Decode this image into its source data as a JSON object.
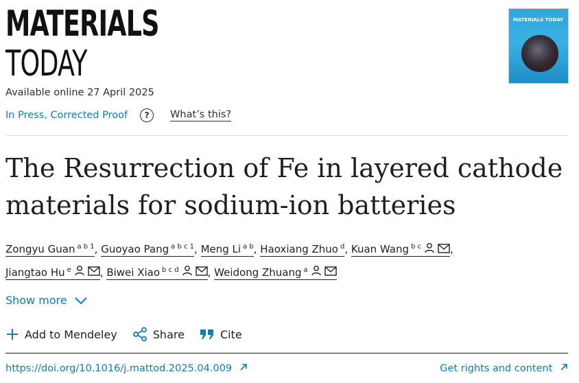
{
  "journal": {
    "name_line1": "MATERIALS",
    "name_line2": "TODAY",
    "cover_title": "MATERIALS TODAY"
  },
  "availability": "Available online 27 April 2025",
  "status": {
    "label": "In Press, Corrected Proof",
    "help_label": "What’s this?"
  },
  "article": {
    "title": "The Resurrection of Fe in layered cathode materials for sodium-ion batteries"
  },
  "authors": [
    {
      "name": "Zongyu Guan",
      "sup": "a b 1",
      "icons": false
    },
    {
      "name": "Guoyao Pang",
      "sup": "a b c 1",
      "icons": false
    },
    {
      "name": "Meng Li",
      "sup": "a b",
      "icons": false
    },
    {
      "name": "Haoxiang Zhuo",
      "sup": "d",
      "icons": false
    },
    {
      "name": "Kuan Wang",
      "sup": "b c",
      "icons": true
    },
    {
      "name": "Jiangtao Hu",
      "sup": "e",
      "icons": true
    },
    {
      "name": "Biwei Xiao",
      "sup": "b c d",
      "icons": true
    },
    {
      "name": "Weidong Zhuang",
      "sup": "a",
      "icons": true
    }
  ],
  "show_more": "Show more",
  "actions": {
    "mendeley": "Add to Mendeley",
    "share": "Share",
    "cite": "Cite"
  },
  "doi": "https://doi.org/10.1016/j.mattod.2025.04.009",
  "rights": "Get rights and content",
  "colors": {
    "link": "#0c7dbb",
    "text": "#1f1f1f"
  }
}
